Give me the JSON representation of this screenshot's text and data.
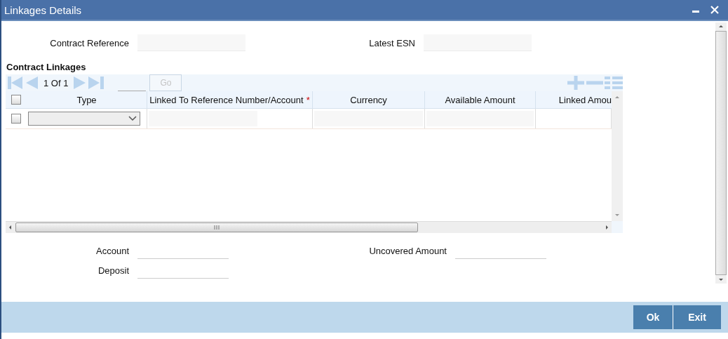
{
  "window": {
    "title": "Linkages Details"
  },
  "top_fields": [
    {
      "label": "Contract Reference"
    },
    {
      "label": "Latest ESN"
    }
  ],
  "section": {
    "title": "Contract Linkages"
  },
  "pager": {
    "text": "1 Of 1",
    "go": {
      "label": "Go",
      "disabled": true
    }
  },
  "table": {
    "select_all": {
      "checked": false
    },
    "required_mark": "*",
    "columns": [
      {
        "label": "Type",
        "required": false
      },
      {
        "label": "Linked To Reference Number/Account",
        "required": true
      },
      {
        "label": "Currency",
        "required": false
      },
      {
        "label": "Available Amount",
        "required": false
      },
      {
        "label": "Linked Amou",
        "required": false
      }
    ],
    "rows": [
      {
        "checked": false
      }
    ]
  },
  "bottom_fields": [
    {
      "label": "Account"
    },
    {
      "label": "Uncovered Amount"
    },
    {
      "label": "Deposit"
    }
  ],
  "buttons": [
    {
      "label": "Ok"
    },
    {
      "label": "Exit"
    }
  ]
}
